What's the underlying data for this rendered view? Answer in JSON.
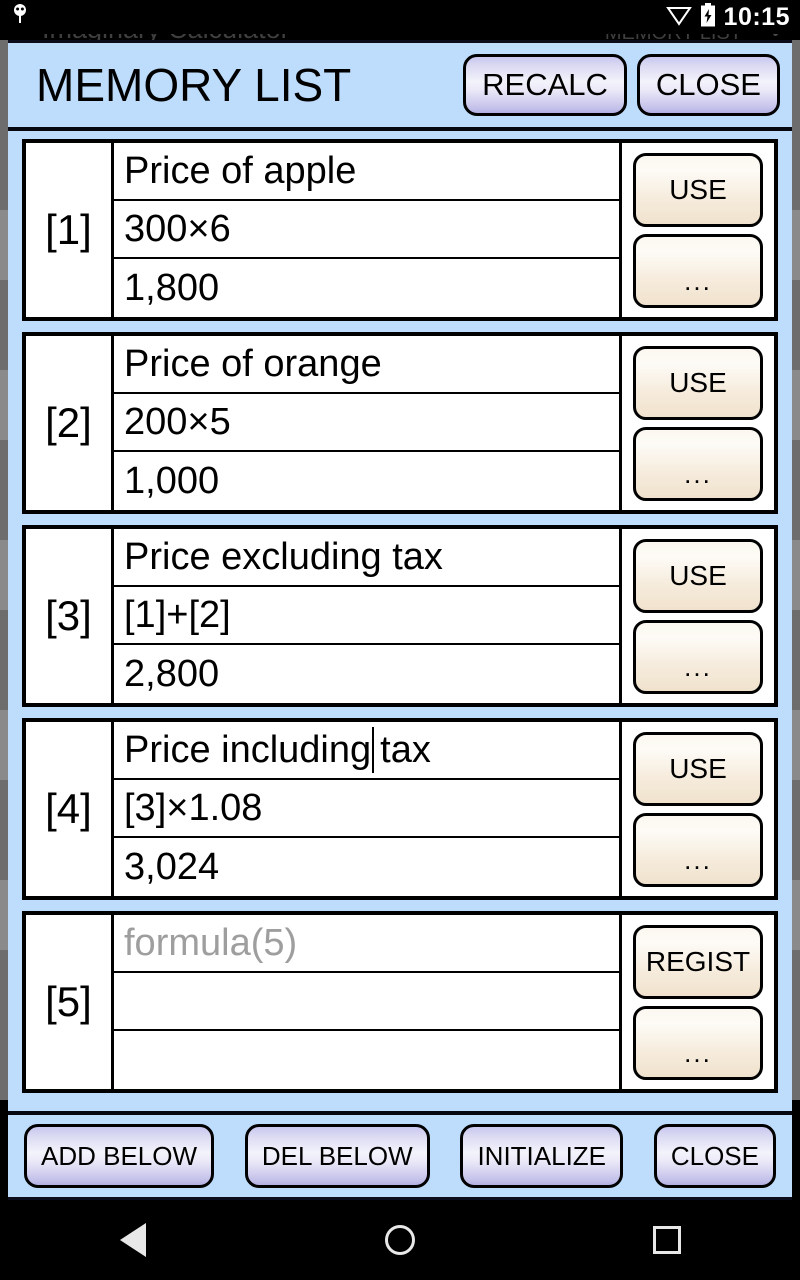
{
  "statusbar": {
    "time": "10:15",
    "wifi_icon": "wifi-icon",
    "battery_icon": "battery-charging-icon",
    "notification_icon": "android-notification-icon"
  },
  "background_app": {
    "title": "Imaginary Calculator",
    "action_label": "MEMORY LIST",
    "overflow_icon": "overflow-menu-icon"
  },
  "dialog": {
    "title": "MEMORY LIST",
    "header_buttons": [
      {
        "label": "RECALC",
        "name": "recalc-button"
      },
      {
        "label": "CLOSE",
        "name": "close-button"
      }
    ],
    "items": [
      {
        "index": "[1]",
        "name": "Price of apple",
        "formula": "300×6",
        "result": "1,800",
        "name_placeholder": "",
        "primary_action": "USE",
        "more_action": "...",
        "caret_after": null,
        "is_empty": false
      },
      {
        "index": "[2]",
        "name": "Price of orange",
        "formula": "200×5",
        "result": "1,000",
        "name_placeholder": "",
        "primary_action": "USE",
        "more_action": "...",
        "caret_after": null,
        "is_empty": false
      },
      {
        "index": "[3]",
        "name": "Price excluding tax",
        "formula": "[1]+[2]",
        "result": "2,800",
        "name_placeholder": "",
        "primary_action": "USE",
        "more_action": "...",
        "caret_after": null,
        "is_empty": false
      },
      {
        "index": "[4]",
        "name": "Price including tax",
        "name_before_caret": "Price including",
        "name_after_caret": "tax",
        "formula": "[3]×1.08",
        "result": "3,024",
        "name_placeholder": "",
        "primary_action": "USE",
        "more_action": "...",
        "caret_after": "Price including",
        "is_empty": false
      },
      {
        "index": "[5]",
        "name": "",
        "formula": "",
        "result": "",
        "name_placeholder": "formula(5)",
        "primary_action": "REGIST",
        "more_action": "...",
        "caret_after": null,
        "is_empty": true
      }
    ],
    "toolbar_buttons": [
      {
        "label": "ADD BELOW",
        "name": "add-below-button"
      },
      {
        "label": "DEL BELOW",
        "name": "del-below-button"
      },
      {
        "label": "INITIALIZE",
        "name": "initialize-button"
      },
      {
        "label": "CLOSE",
        "name": "close-bottom-button"
      }
    ]
  },
  "navbar": {
    "back": "back-nav-icon",
    "home": "home-nav-icon",
    "recents": "recents-nav-icon"
  },
  "colors": {
    "dialog_background": "#bedcfb",
    "card_background": "#ffffff",
    "lavender_button": "#d9d8f2",
    "cream_button": "#f6ecdd",
    "placeholder_text": "#9e9e9e",
    "text": "#000000",
    "status_bar": "#000000"
  }
}
